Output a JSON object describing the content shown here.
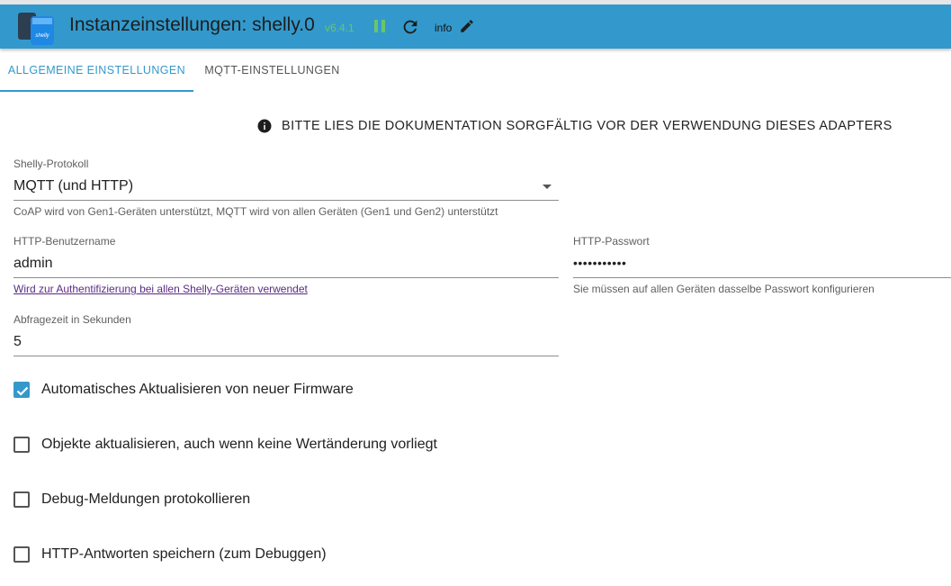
{
  "header": {
    "title": "Instanzeinstellungen: shelly.0",
    "version": "v6.4.1",
    "log_level": "info",
    "logo_text": "shelly",
    "colors": {
      "bar": "#3399cc",
      "version": "#6bc46b"
    },
    "icons": [
      "adapter-logo",
      "pause-icon",
      "reload-icon",
      "edit-icon"
    ]
  },
  "tabs": [
    {
      "label": "ALLGEMEINE EINSTELLUNGEN",
      "active": true
    },
    {
      "label": "MQTT-EINSTELLUNGEN",
      "active": false
    }
  ],
  "notice": {
    "icon": "info-icon",
    "text": "BITTE LIES DIE DOKUMENTATION SORGFÄLTIG VOR DER VERWENDUNG DIESES ADAPTERS"
  },
  "protocol": {
    "label": "Shelly-Protokoll",
    "value": "MQTT (und HTTP)",
    "helper": "CoAP wird von Gen1-Geräten unterstützt, MQTT wird von allen Geräten (Gen1 und Gen2) unterstützt"
  },
  "http_user": {
    "label": "HTTP-Benutzername",
    "value": "admin",
    "helper_link": "Wird zur Authentifizierung bei allen Shelly-Geräten verwendet"
  },
  "http_password": {
    "label": "HTTP-Passwort",
    "value": "•••••••••••",
    "helper": "Sie müssen auf allen Geräten dasselbe Passwort konfigurieren"
  },
  "polling": {
    "label": "Abfragezeit in Sekunden",
    "value": "5"
  },
  "checkboxes": [
    {
      "label": "Automatisches Aktualisieren von neuer Firmware",
      "checked": true
    },
    {
      "label": "Objekte aktualisieren, auch wenn keine Wertänderung vorliegt",
      "checked": false
    },
    {
      "label": "Debug-Meldungen protokollieren",
      "checked": false
    },
    {
      "label": "HTTP-Antworten speichern (zum Debuggen)",
      "checked": false
    }
  ]
}
